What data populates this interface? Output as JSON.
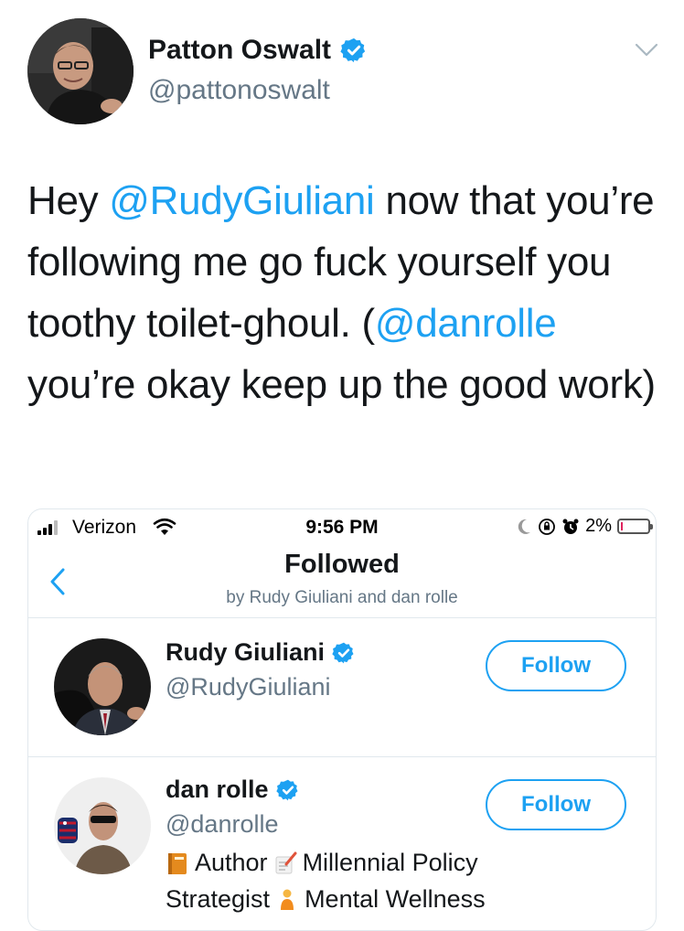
{
  "tweet": {
    "author_name": "Patton Oswalt",
    "author_handle": "@pattonoswalt",
    "text_parts": {
      "p1": "Hey ",
      "mention1": "@RudyGiuliani",
      "p2": " now that you’re following me go fuck yourself you toothy toilet-ghoul. (",
      "mention2": "@danrolle",
      "p3": " you’re okay keep up the good work)"
    }
  },
  "screenshot": {
    "status_bar": {
      "carrier": "Verizon",
      "time": "9:56 PM",
      "battery": "2%",
      "battery_level_percent": 2
    },
    "nav": {
      "title": "Followed",
      "subtitle": "by Rudy Giuliani and dan rolle"
    },
    "users": [
      {
        "name": "Rudy Giuliani",
        "handle": "@RudyGiuliani",
        "button_label": "Follow"
      },
      {
        "name": "dan rolle",
        "handle": "@danrolle",
        "button_label": "Follow",
        "bio_line1": {
          "w1": "Author",
          "w2": "Millennial Policy"
        },
        "bio_line2": {
          "w1": "Strategist",
          "w2": "Mental Wellness"
        }
      }
    ]
  },
  "colors": {
    "link_blue": "#1da1f2",
    "text_primary": "#14171a",
    "text_secondary": "#657786",
    "divider": "#e1e8ed"
  },
  "icons": {
    "verified": "verified-badge-icon",
    "more": "chevron-down-icon",
    "back": "chevron-left-icon",
    "wifi": "wifi-icon",
    "signal": "cellular-signal-icon",
    "battery": "battery-icon"
  }
}
